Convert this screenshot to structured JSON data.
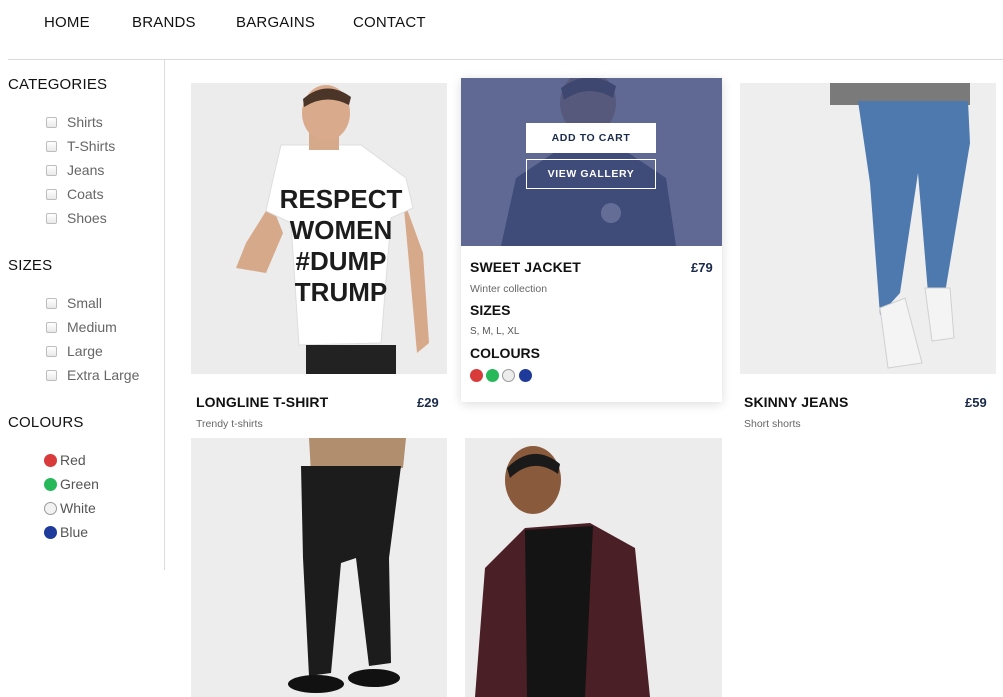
{
  "nav": {
    "items": [
      "HOME",
      "BRANDS",
      "BARGAINS",
      "CONTACT"
    ]
  },
  "sidebar": {
    "categories_heading": "CATEGORIES",
    "categories": [
      "Shirts",
      "T-Shirts",
      "Jeans",
      "Coats",
      "Shoes"
    ],
    "sizes_heading": "SIZES",
    "sizes": [
      "Small",
      "Medium",
      "Large",
      "Extra Large"
    ],
    "colours_heading": "COLOURS",
    "colours": [
      {
        "label": "Red",
        "color": "#d93a3a"
      },
      {
        "label": "Green",
        "color": "#27b85a"
      },
      {
        "label": "White",
        "color": "#f2f2f2"
      },
      {
        "label": "Blue",
        "color": "#1e3a9a"
      }
    ]
  },
  "products": [
    {
      "name": "LONGLINE T-SHIRT",
      "price": "£29",
      "subtitle": "Trendy t-shirts",
      "tshirt_print": [
        "RESPECT",
        "WOMEN",
        "#DUMP",
        "TRUMP"
      ]
    },
    {
      "name": "SWEET JACKET",
      "price": "£79",
      "subtitle": "Winter collection",
      "sizes_title": "SIZES",
      "sizes": "S, M, L, XL",
      "colours_title": "COLOURS",
      "colours": [
        "#d93a3a",
        "#27b85a",
        "#ececec",
        "#1e3a9a"
      ],
      "add_to_cart": "ADD TO CART",
      "view_gallery": "VIEW GALLERY"
    },
    {
      "name": "SKINNY JEANS",
      "price": "£59",
      "subtitle": "Short shorts"
    },
    {
      "name": "",
      "price": "",
      "subtitle": ""
    },
    {
      "name": "",
      "price": "",
      "subtitle": ""
    }
  ]
}
